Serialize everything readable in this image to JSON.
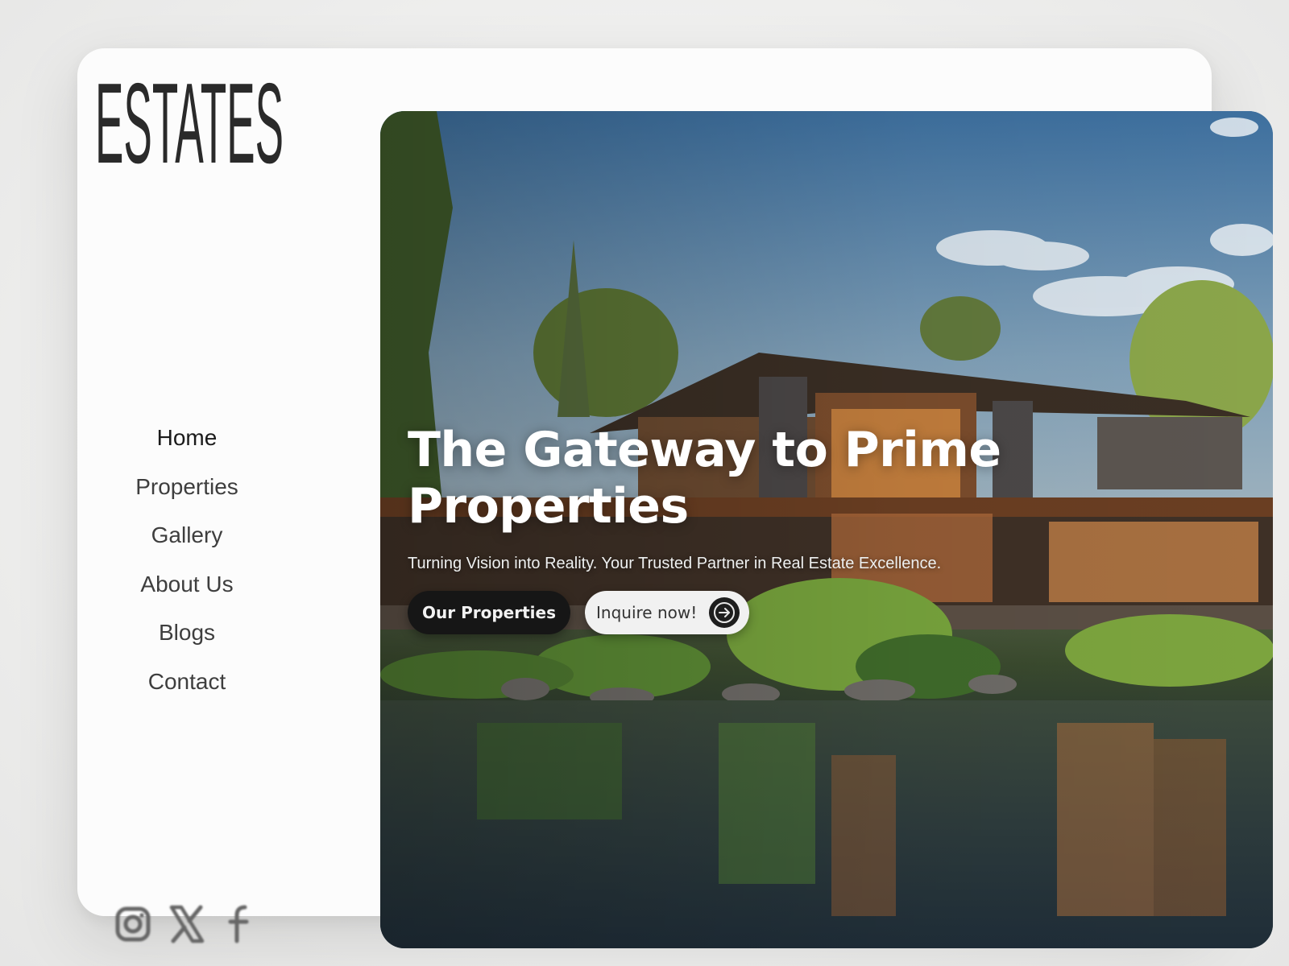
{
  "brand": {
    "logo_text": "ESTATES"
  },
  "nav": {
    "items": [
      {
        "label": "Home"
      },
      {
        "label": "Properties"
      },
      {
        "label": "Gallery"
      },
      {
        "label": "About Us"
      },
      {
        "label": "Blogs"
      },
      {
        "label": "Contact"
      }
    ]
  },
  "social": {
    "icons": [
      "instagram-icon",
      "x-icon",
      "facebook-icon"
    ]
  },
  "hero": {
    "title": "The Gateway to Prime Properties",
    "subtitle": "Turning Vision into Reality. Your Trusted Partner in Real Estate Excellence.",
    "primary_button": "Our Properties",
    "secondary_button": "Inquire now!"
  },
  "colors": {
    "text_dark": "#2a2a2a",
    "button_dark": "#161616",
    "button_light": "#f1f1f1"
  }
}
